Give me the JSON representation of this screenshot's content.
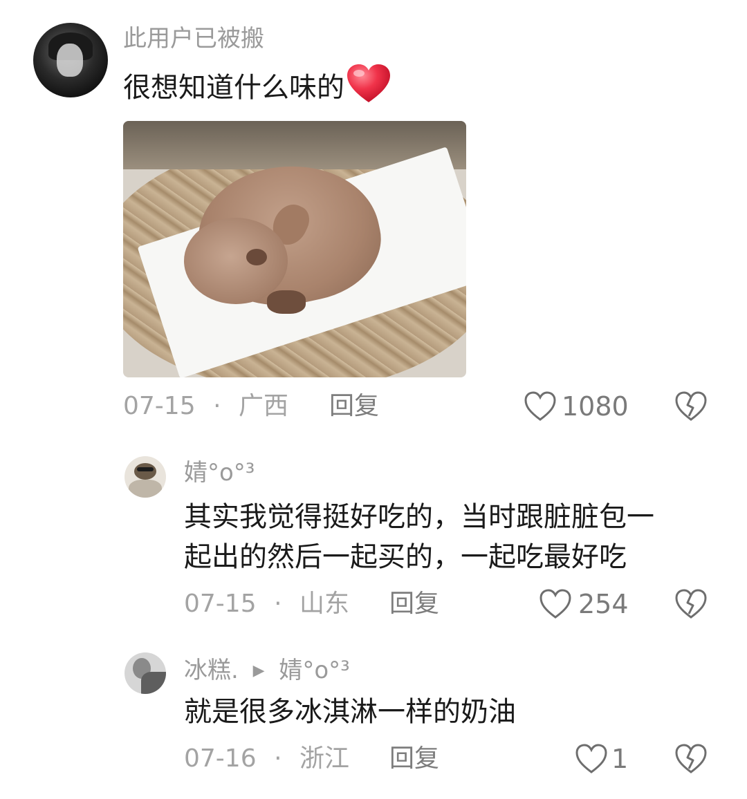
{
  "comments": [
    {
      "username": "此用户已被搬",
      "text": "很想知道什么味的",
      "emoji": "❤️",
      "date": "07-15",
      "separator": "·",
      "location": "广西",
      "reply_label": "回复",
      "likes": "1080"
    }
  ],
  "replies": [
    {
      "username": "婧°o°³",
      "text_line1": "其实我觉得挺好吃的，当时跟脏脏包一",
      "text_line2": "起出的然后一起买的，一起吃最好吃",
      "date": "07-15",
      "separator": "·",
      "location": "山东",
      "reply_label": "回复",
      "likes": "254"
    },
    {
      "username": "冰糕.",
      "reply_to_arrow": "▶",
      "reply_to": "婧°o°³",
      "text": "就是很多冰淇淋一样的奶油",
      "date": "07-16",
      "separator": "·",
      "location": "浙江",
      "reply_label": "回复",
      "likes": "1"
    }
  ],
  "icons": {
    "like": "heart-outline-icon",
    "dislike": "broken-heart-icon"
  },
  "colors": {
    "emoji_heart": "#e8243f",
    "meta_gray": "#a3a3a3",
    "text_dark": "#1a1a1a"
  }
}
